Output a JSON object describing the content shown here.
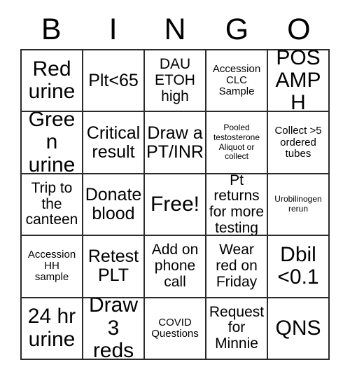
{
  "card": {
    "title": "BINGO",
    "header_letters": [
      "B",
      "I",
      "N",
      "G",
      "O"
    ],
    "columns": 5,
    "rows": 5,
    "free_space_index": 12,
    "colors": {
      "background": "#ffffff",
      "text": "#000000",
      "grid_line": "#2b2b2b"
    },
    "cells": [
      {
        "text": "Red\nurine",
        "size": "xl"
      },
      {
        "text": "Plt<65",
        "size": "lg"
      },
      {
        "text": "DAU\nETOH\nhigh",
        "size": "md"
      },
      {
        "text": "Accession\nCLC\nSample",
        "size": "sm"
      },
      {
        "text": "POS\nAMPH",
        "size": "xl"
      },
      {
        "text": "Green\nurine",
        "size": "xl"
      },
      {
        "text": "Critical\nresult",
        "size": "lg"
      },
      {
        "text": "Draw a\nPT/INR",
        "size": "lg"
      },
      {
        "text": "Pooled\ntestosterone\nAliquot or\ncollect",
        "size": "xs"
      },
      {
        "text": "Collect >5\nordered\ntubes",
        "size": "sm"
      },
      {
        "text": "Trip to\nthe\ncanteen",
        "size": "md"
      },
      {
        "text": "Donate\nblood",
        "size": "lg"
      },
      {
        "text": "Free!",
        "size": "xl"
      },
      {
        "text": "Pt returns\nfor more\ntesting",
        "size": "md"
      },
      {
        "text": "Urobilinogen\nrerun",
        "size": "xs"
      },
      {
        "text": "Accession\nHH\nsample",
        "size": "sm"
      },
      {
        "text": "Retest\nPLT",
        "size": "lg"
      },
      {
        "text": "Add on\nphone\ncall",
        "size": "md"
      },
      {
        "text": "Wear\nred on\nFriday",
        "size": "md"
      },
      {
        "text": "Dbil\n<0.1",
        "size": "xl"
      },
      {
        "text": "24 hr\nurine",
        "size": "xl"
      },
      {
        "text": "Draw\n3 reds",
        "size": "xl"
      },
      {
        "text": "COVID\nQuestions",
        "size": "sm"
      },
      {
        "text": "Request\nfor\nMinnie",
        "size": "md"
      },
      {
        "text": "QNS",
        "size": "xl"
      }
    ]
  }
}
